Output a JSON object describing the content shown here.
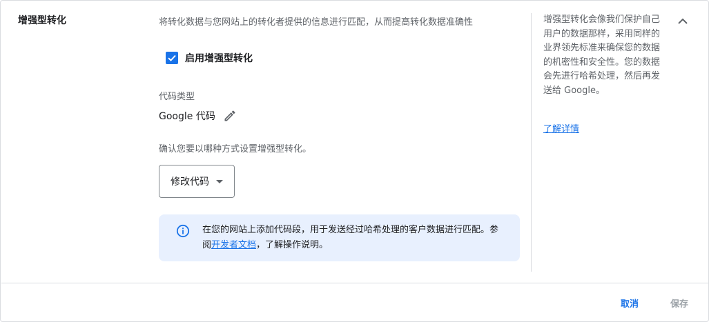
{
  "section": {
    "title": "增强型转化",
    "description": "将转化数据与您网站上的转化者提供的信息进行匹配，从而提高转化数据准确性"
  },
  "enable_checkbox": {
    "label": "启用增强型转化",
    "checked": true
  },
  "code_type": {
    "label": "代码类型",
    "value": "Google 代码",
    "edit_icon": "pencil-icon"
  },
  "setup": {
    "prompt": "确认您要以哪种方式设置增强型转化。",
    "dropdown_selected": "修改代码"
  },
  "info_box": {
    "icon": "info-icon",
    "text_before_link": "在您的网站上添加代码段，用于发送经过哈希处理的客户数据进行匹配。参阅",
    "link_text": "开发者文档",
    "text_after_link": "，了解操作说明。"
  },
  "sidebar": {
    "text": "增强型转化会像我们保护自己用户的数据那样，采用同样的业界领先标准来确保您的数据的机密性和安全性。您的数据会先进行哈希处理，然后再发送给 Google。",
    "link": "了解详情"
  },
  "footer": {
    "cancel_label": "取消",
    "save_label": "保存"
  },
  "colors": {
    "accent": "#1a73e8",
    "info_bg": "#e8f0fe",
    "disabled": "#9aa0a6"
  }
}
